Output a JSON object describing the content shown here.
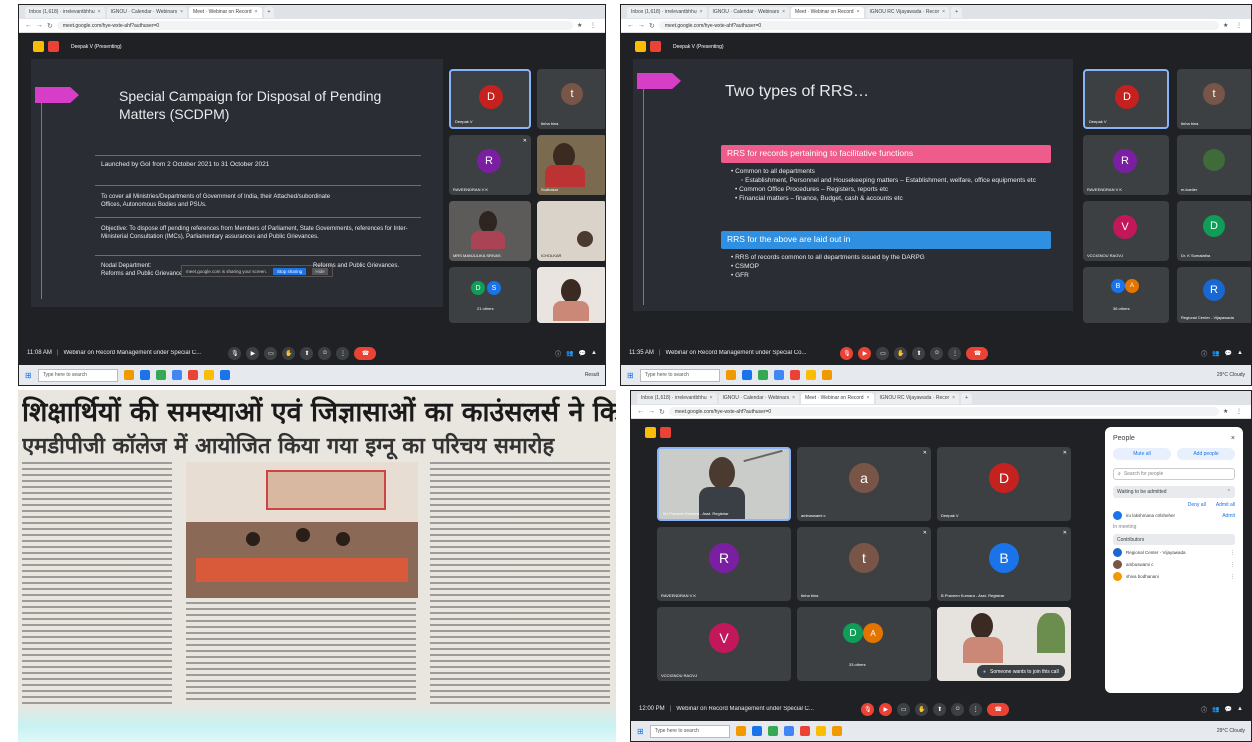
{
  "q1": {
    "tabs": [
      "Inbox (1,618) · irrelevantbhhu",
      "IGNOU · Calendar · Webinars",
      "Meet · Webinar on Record",
      "+"
    ],
    "url": "meet.google.com/hye-wxte-ahf?authuser=0",
    "presenter": "Deepak V (Presenting)",
    "slide": {
      "title": "Special Campaign for Disposal of Pending Matters (SCDPM)",
      "lines": [
        "Launched by GoI from 2 October 2021 to 31 October 2021",
        "To cover all Ministries/Departments of Government of India, their Attached/subordinate Offices, Autonomous Bodies and PSUs.",
        "Objective: To dispose off pending references from Members of Parliament, State Governments, references for Inter-Ministerial Consultation (IMCs), Parliamentary assurances and Public Grievances.",
        "Nodal Department:",
        "Reforms and Public Grievances."
      ],
      "banner_text": "meet.google.com is sharing your screen.",
      "banner_stop": "Stop sharing",
      "banner_hide": "Hide"
    },
    "tiles": [
      {
        "initial": "D",
        "name": "Deepak V",
        "color": "#c5221f"
      },
      {
        "initial": "t",
        "name": "tinha bina",
        "color": "#795548"
      },
      {
        "initial": "R",
        "name": "RAVEENDRAN V K",
        "color": "#7b1fa2"
      },
      {
        "initial": "",
        "name": "Sudhakar",
        "color": ""
      },
      {
        "initial": "",
        "name": "MRS MANJULIKA SRIVAS",
        "color": ""
      },
      {
        "initial": "",
        "name": "ICHOLKAR",
        "color": ""
      },
      {
        "initial": "D",
        "initial2": "S",
        "name": "21 others",
        "color": "#0f9d58"
      },
      {
        "initial": "",
        "name": "",
        "color": ""
      }
    ],
    "time": "11:08 AM",
    "meeting": "Webinar on Record Management under Special C...",
    "search_placeholder": "Type here to search",
    "tray": "Result"
  },
  "q2": {
    "tabs": [
      "Inbox (1,618) · irrelevantbhhu",
      "IGNOU · Calendar · Webinars",
      "Meet · Webinar on Record",
      "IGNOU RC Vijayawada · Recor",
      "+"
    ],
    "url": "meet.google.com/hye-wxte-ahf?authuser=0",
    "presenter": "Deepak V (Presenting)",
    "slide": {
      "title": "Two types of RRS…",
      "box1": "RRS for records pertaining to facilitative functions",
      "bullets1": [
        "• Common to all departments",
        "◦ Establishment, Personnel and Housekeeping matters – Establishment, welfare, office equipments etc",
        "• Common Office Procedures – Registers, reports etc",
        "• Financial matters – finance, Budget, cash & accounts etc"
      ],
      "box2": "RRS for the above are laid out in",
      "bullets2": [
        "• RRS of records common to all departments issued by the DARPG",
        "• CSMOP",
        "• GFR"
      ]
    },
    "tiles": [
      {
        "initial": "D",
        "name": "Deepak V",
        "color": "#c5221f"
      },
      {
        "initial": "t",
        "name": "tinha bina",
        "color": "#795548"
      },
      {
        "initial": "R",
        "name": "RAVEENDRAN V K",
        "color": "#7b1fa2"
      },
      {
        "initial": "",
        "name": "m.lcarlier",
        "color": ""
      },
      {
        "initial": "V",
        "name": "VCCIGNOU RAOVJ",
        "color": "#c2185b"
      },
      {
        "initial": "D",
        "name": "Dr. K Somalatha",
        "color": "#0f9d58"
      },
      {
        "initial": "B",
        "initial2": "A",
        "name": "36 others",
        "color": "#1a73e8"
      },
      {
        "initial": "R",
        "name": "Regional Center - Vijayawada",
        "color": "#1967d2"
      }
    ],
    "time": "11:35 AM",
    "meeting": "Webinar on Record Management under Special Co...",
    "search_placeholder": "Type here to search",
    "tray": "29°C Cloudy"
  },
  "q3": {
    "headline": "शिक्षार्थियों की समस्याओं एवं जिज्ञासाओं का काउंसलर्स ने किया समाधान",
    "subhead": "एमडीपीजी कॉलेज में आयोजित किया गया इग्नू का परिचय समारोह"
  },
  "q4": {
    "tabs": [
      "Inbox (1,618) · irrelevantbhhu",
      "IGNOU · Calendar · Webinars",
      "Meet · Webinar on Record",
      "IGNOU RC Vijayawada · Recor",
      "+"
    ],
    "url": "meet.google.com/hye-wxte-ahf?authuser=0",
    "tiles": [
      {
        "initial": "",
        "name": "Sri Praveen Kumara - Asst. Registrar",
        "color": ""
      },
      {
        "initial": "a",
        "name": "ambuswami c",
        "color": "#795548"
      },
      {
        "initial": "D",
        "name": "Deepak V",
        "color": "#c5221f"
      },
      {
        "initial": "R",
        "name": "RAVEENDRAN V K",
        "color": "#7b1fa2"
      },
      {
        "initial": "t",
        "name": "tinha bina",
        "color": "#795548"
      },
      {
        "initial": "B",
        "name": "B.Praveen Kumara - Asst. Registrar",
        "color": "#1a73e8"
      },
      {
        "initial": "V",
        "name": "VCCIGNOU RAOVJ",
        "color": "#c2185b"
      },
      {
        "initial": "D",
        "initial2": "A",
        "name": "33 others",
        "color": "#0f9d58"
      },
      {
        "initial": "",
        "name": "",
        "color": ""
      }
    ],
    "toast": "Someone wants to join this call",
    "panel": {
      "title": "People",
      "mute_all": "Mute all",
      "add_people": "Add people",
      "search": "Search for people",
      "section": "Waiting to be admitted",
      "deny_all": "Deny all",
      "admit_all": "Admit all",
      "waiting_person": "iru lakshmana ctrlsheher",
      "admit": "Admit",
      "in_meeting": "In meeting",
      "contributors": "Contributors",
      "people": [
        "Regional Center - Vijayawada",
        "ambuswami c",
        "shiva bodhanani"
      ],
      "hosts": "Host"
    },
    "time": "12:00 PM",
    "meeting": "Webinar on Record Management under Special C...",
    "search_placeholder": "Type here to search",
    "tray": "29°C Cloudy"
  }
}
